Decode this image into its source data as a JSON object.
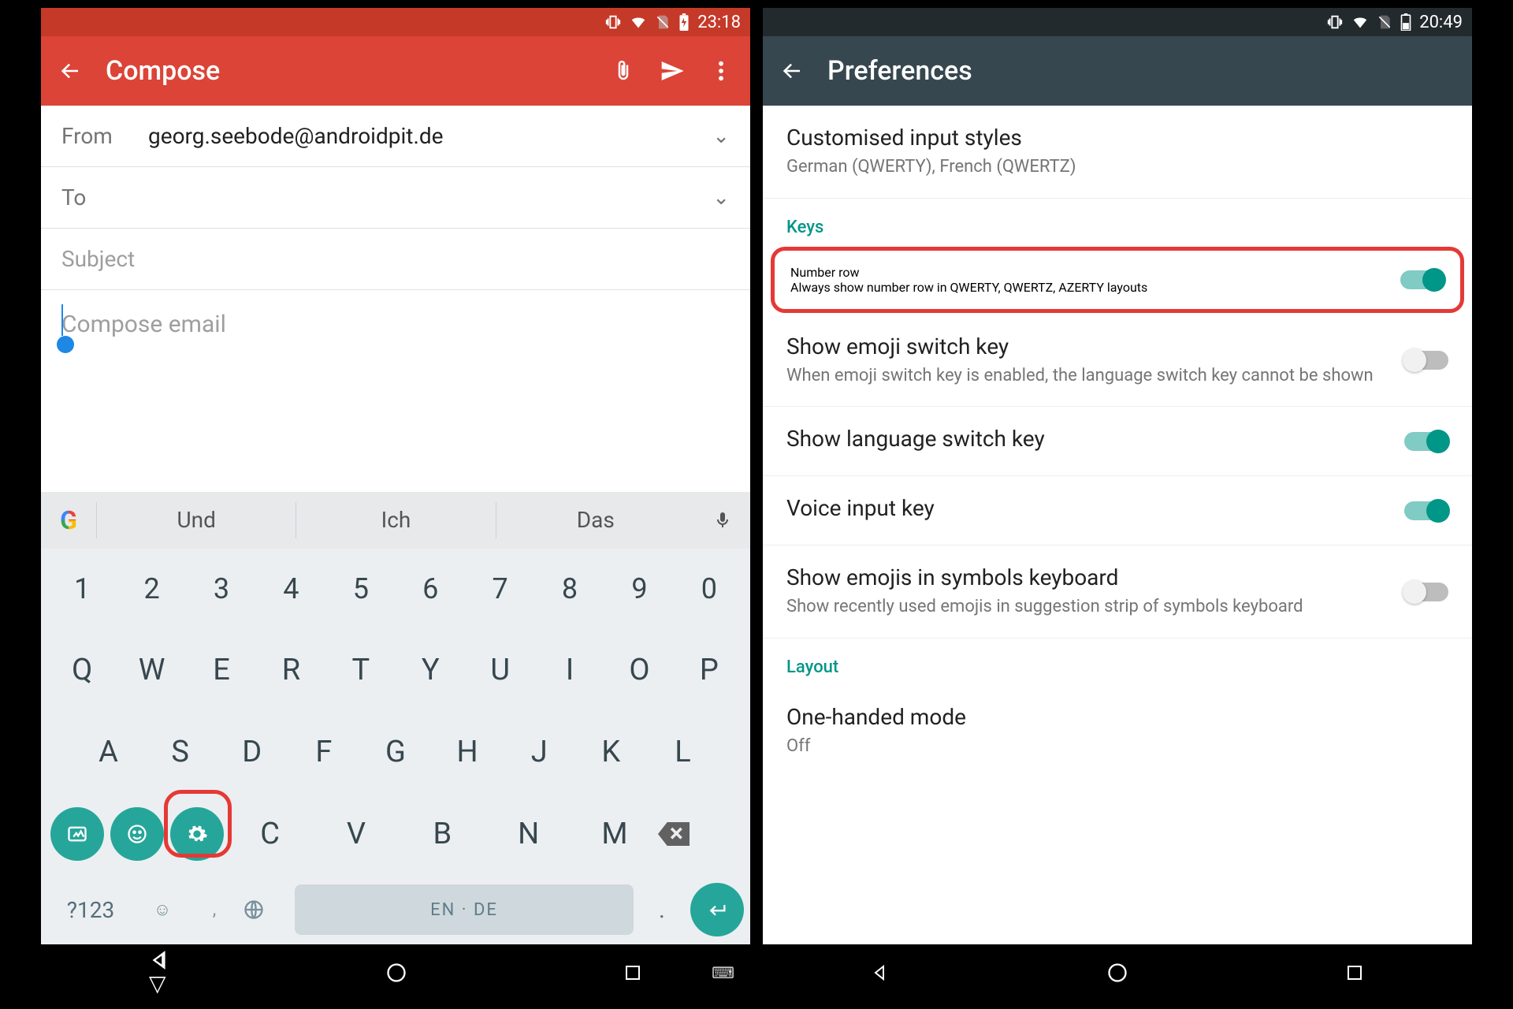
{
  "left": {
    "status": {
      "time": "23:18"
    },
    "appbar": {
      "title": "Compose"
    },
    "from": {
      "label": "From",
      "value": "georg.seebode@androidpit.de"
    },
    "to": {
      "label": "To",
      "value": ""
    },
    "subject": {
      "placeholder": "Subject"
    },
    "body": {
      "placeholder": "Compose email"
    },
    "keyboard": {
      "suggestions": [
        "Und",
        "Ich",
        "Das"
      ],
      "row_num": [
        "1",
        "2",
        "3",
        "4",
        "5",
        "6",
        "7",
        "8",
        "9",
        "0"
      ],
      "row1": [
        "Q",
        "W",
        "E",
        "R",
        "T",
        "Y",
        "U",
        "I",
        "O",
        "P"
      ],
      "row2": [
        "A",
        "S",
        "D",
        "F",
        "G",
        "H",
        "J",
        "K",
        "L"
      ],
      "row3_letters": [
        "C",
        "V",
        "B",
        "N",
        "M"
      ],
      "sym_key": "?123",
      "space_label": "EN · DE"
    }
  },
  "right": {
    "status": {
      "time": "20:49"
    },
    "appbar": {
      "title": "Preferences"
    },
    "custom": {
      "title": "Customised input styles",
      "sub": "German (QWERTY), French (QWERTZ)"
    },
    "section_keys": "Keys",
    "number_row": {
      "title": "Number row",
      "sub": "Always show number row in QWERTY, QWERTZ, AZERTY layouts"
    },
    "emoji_switch": {
      "title": "Show emoji switch key",
      "sub": "When emoji switch key is enabled, the language switch key cannot be shown"
    },
    "lang_switch": {
      "title": "Show language switch key"
    },
    "voice_input": {
      "title": "Voice input key"
    },
    "emoji_symbols": {
      "title": "Show emojis in symbols keyboard",
      "sub": "Show recently used emojis in suggestion strip of symbols keyboard"
    },
    "section_layout": "Layout",
    "one_handed": {
      "title": "One-handed mode",
      "sub": "Off"
    }
  }
}
